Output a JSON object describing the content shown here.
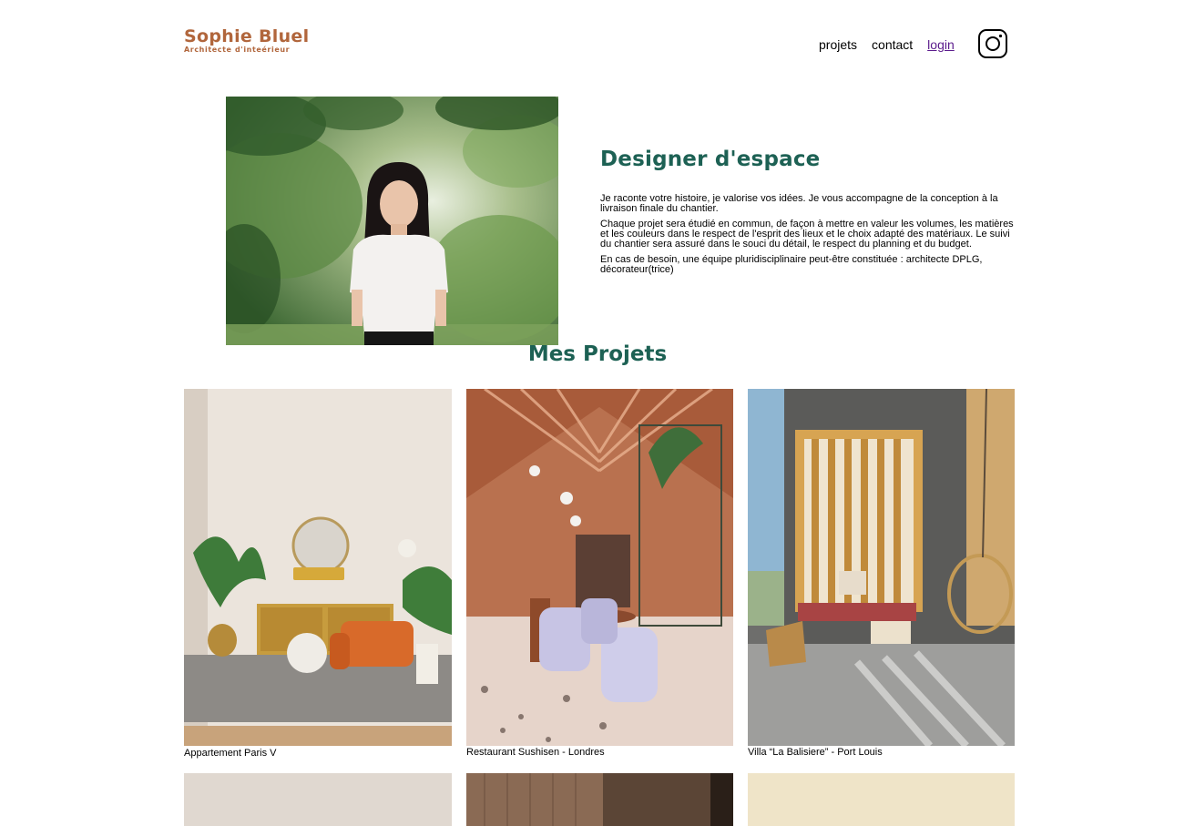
{
  "header": {
    "logo_name": "Sophie Bluel",
    "logo_subtitle": "Architecte d'inteérieur",
    "nav": [
      {
        "label": "projets"
      },
      {
        "label": "contact"
      },
      {
        "label": "login"
      }
    ],
    "instagram_icon": "instagram-icon"
  },
  "introduction": {
    "title": "Designer d'espace",
    "paragraphs": [
      "Je raconte votre histoire, je valorise vos idées. Je vous accompagne de la conception à la livraison finale du chantier.",
      "Chaque projet sera étudié en commun, de façon à mettre en valeur les volumes, les matières et les couleurs dans le respect de l'esprit des lieux et le choix adapté des matériaux. Le suivi du chantier sera assuré dans le souci du détail, le respect du planning et du budget.",
      "En cas de besoin, une équipe pluridisciplinaire peut-être constituée : architecte DPLG, décorateur(trice)"
    ]
  },
  "portfolio": {
    "title": "Mes Projets",
    "projects": [
      {
        "caption": "Appartement Paris V"
      },
      {
        "caption": "Restaurant Sushisen - Londres"
      },
      {
        "caption": "Villa “La Balisiere” - Port Louis"
      },
      {
        "caption": ""
      },
      {
        "caption": ""
      },
      {
        "caption": ""
      }
    ]
  },
  "colors": {
    "brand": "#B1663C",
    "heading": "#1D6154",
    "link_visited": "#5b1b8c"
  }
}
